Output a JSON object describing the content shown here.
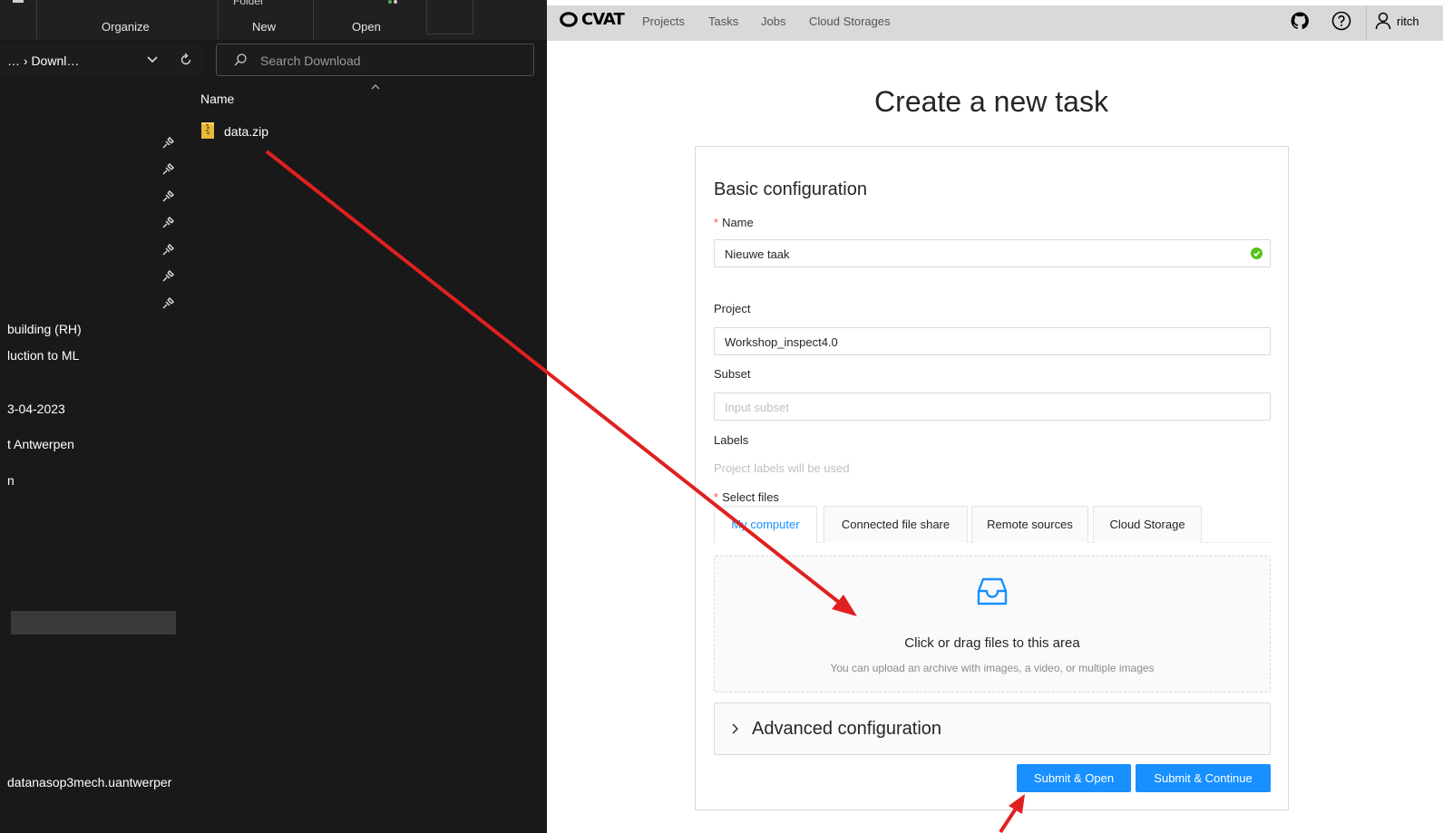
{
  "explorer": {
    "ribbon": {
      "folder_fragment": "Folder",
      "groups": [
        "Organize",
        "New",
        "Open"
      ]
    },
    "address": {
      "path": "… › Downl…",
      "search_placeholder": "Search Download"
    },
    "nav_items": [
      "building (RH)",
      "luction to ML",
      "3-04-2023",
      "t Antwerpen",
      "n",
      "datanasop3mech.uantwerper"
    ],
    "file_list": {
      "column_name": "Name",
      "files": [
        {
          "name": "data.zip",
          "icon": "zip-folder-icon"
        }
      ]
    }
  },
  "cvat": {
    "logo_text": "CVAT",
    "nav": [
      "Projects",
      "Tasks",
      "Jobs",
      "Cloud Storages"
    ],
    "user": "ritch",
    "page_title": "Create a new task",
    "form": {
      "section_title": "Basic configuration",
      "name_label": "Name",
      "name_value": "Nieuwe taak",
      "project_label": "Project",
      "project_value": "Workshop_inspect4.0",
      "subset_label": "Subset",
      "subset_placeholder": "Input subset",
      "labels_label": "Labels",
      "labels_hint": "Project labels will be used",
      "select_files_label": "Select files",
      "tabs": [
        "My computer",
        "Connected file share",
        "Remote sources",
        "Cloud Storage"
      ],
      "active_tab": "My computer",
      "dropzone_text": "Click or drag files to this area",
      "dropzone_hint": "You can upload an archive with images, a video, or multiple images",
      "advanced_label": "Advanced configuration",
      "submit_open": "Submit & Open",
      "submit_continue": "Submit & Continue"
    },
    "colors": {
      "primary": "#1890ff",
      "required": "#ff4d4f",
      "success": "#52c41a",
      "annotation_arrow": "#e02020"
    }
  }
}
